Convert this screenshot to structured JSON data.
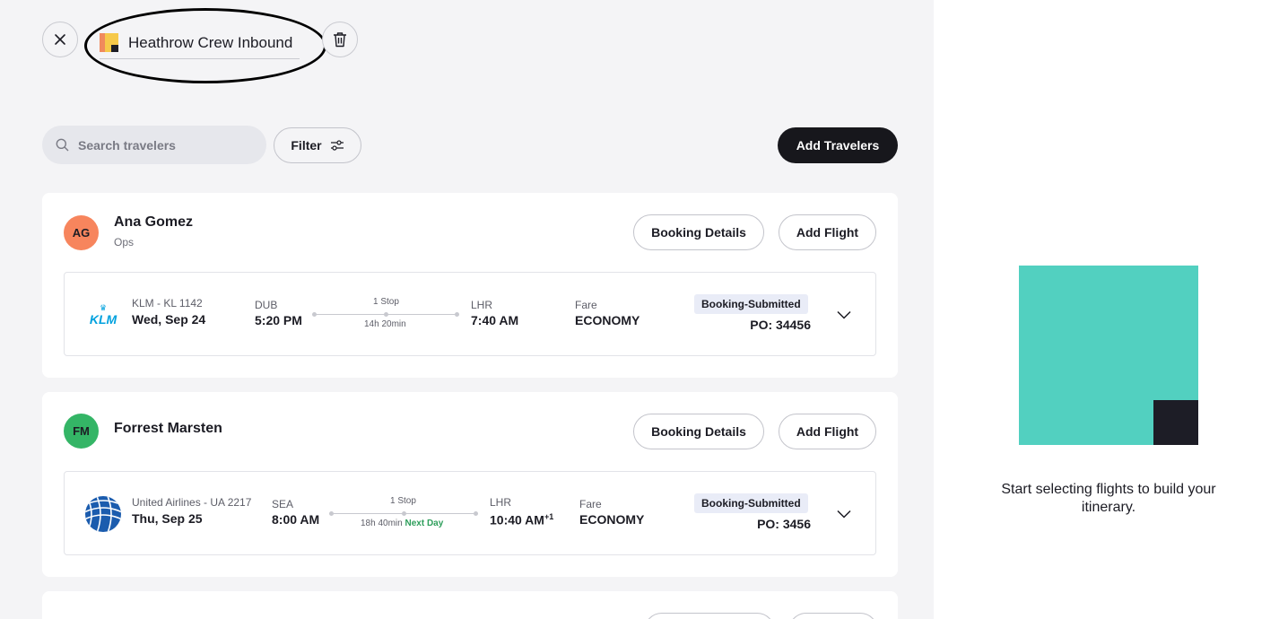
{
  "header": {
    "title_value": "Heathrow Crew Inbound",
    "close_icon": "close-icon",
    "delete_icon": "trash-icon",
    "title_icon": "sticky-note-icon"
  },
  "toolbar": {
    "search_placeholder": "Search travelers",
    "filter_label": "Filter",
    "add_travelers_label": "Add Travelers"
  },
  "travelers": [
    {
      "initials": "AG",
      "name": "Ana Gomez",
      "department": "Ops",
      "avatar_color": "#f7855d",
      "booking_details_label": "Booking Details",
      "add_flight_label": "Add Flight",
      "flight": {
        "airline_logo": "KLM",
        "airline_code": "KLM - KL 1142",
        "date": "Wed, Sep 24",
        "origin": "DUB",
        "depart_time": "5:20 PM",
        "stops": "1 Stop",
        "duration": "14h 20min",
        "destination": "LHR",
        "arrive_time": "7:40 AM",
        "fare_label": "Fare",
        "fare_class": "ECONOMY",
        "status": "Booking-Submitted",
        "po": "PO: 34456"
      }
    },
    {
      "initials": "FM",
      "name": "Forrest Marsten",
      "department": "",
      "avatar_color": "#34b566",
      "booking_details_label": "Booking Details",
      "add_flight_label": "Add Flight",
      "flight": {
        "airline_code": "United Airlines - UA 2217",
        "date": "Thu, Sep 25",
        "origin": "SEA",
        "depart_time": "8:00 AM",
        "stops": "1 Stop",
        "duration": "18h 40min",
        "next_day": "Next Day",
        "destination": "LHR",
        "arrive_time": "10:40 AM",
        "arrive_day_offset": "+1",
        "fare_label": "Fare",
        "fare_class": "ECONOMY",
        "status": "Booking-Submitted",
        "po": "PO: 3456"
      }
    }
  ],
  "empty_state": {
    "message": "Start selecting flights to build your itinerary.",
    "accent_color": "#52d0c0",
    "dark_color": "#1d1d26"
  }
}
